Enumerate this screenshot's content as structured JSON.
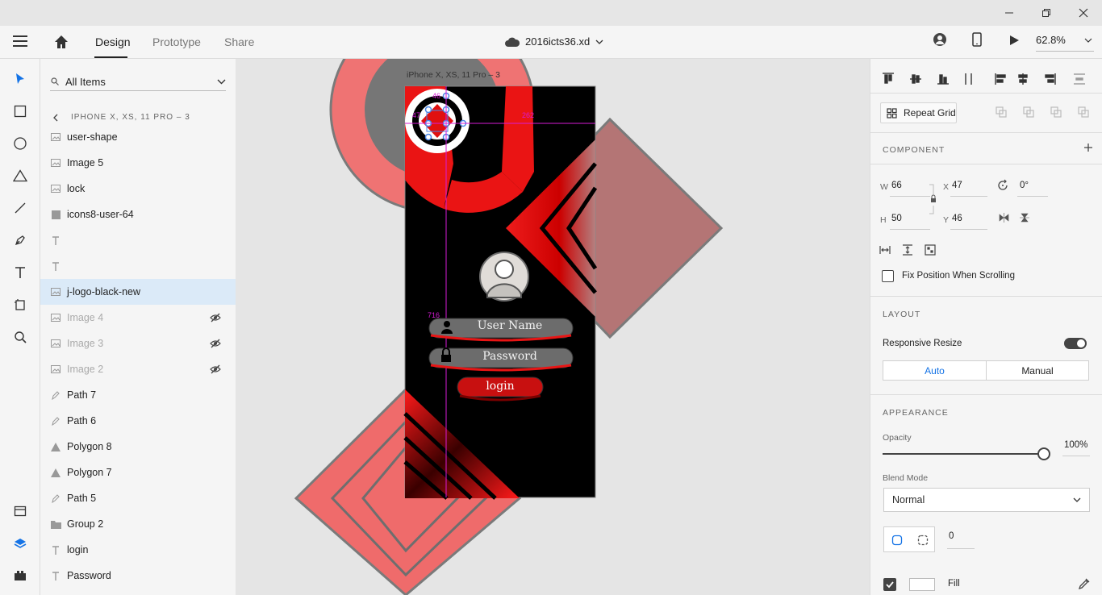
{
  "app": {
    "doc_name": "2016icts36.xd",
    "modes": [
      "Design",
      "Prototype",
      "Share"
    ],
    "zoom": "62.8%"
  },
  "layers": {
    "search_placeholder": "All Items",
    "breadcrumb": "IPHONE X, XS, 11 PRO – 3",
    "items": [
      {
        "name": "user-shape",
        "icon": "image-icon",
        "hidden": false
      },
      {
        "name": "Image 5",
        "icon": "image-icon",
        "hidden": false
      },
      {
        "name": "lock",
        "icon": "image-icon",
        "hidden": false
      },
      {
        "name": "icons8-user-64",
        "icon": "rect-icon",
        "hidden": false
      },
      {
        "name": "",
        "icon": "text-icon",
        "hidden": false
      },
      {
        "name": "",
        "icon": "text-icon",
        "hidden": false
      },
      {
        "name": "j-logo-black-new",
        "icon": "image-icon",
        "hidden": false,
        "selected": true
      },
      {
        "name": "Image 4",
        "icon": "image-icon",
        "hidden": true
      },
      {
        "name": "Image 3",
        "icon": "image-icon",
        "hidden": true
      },
      {
        "name": "Image 2",
        "icon": "image-icon",
        "hidden": true
      },
      {
        "name": "Path 7",
        "icon": "pen-icon",
        "hidden": false
      },
      {
        "name": "Path 6",
        "icon": "pen-icon",
        "hidden": false
      },
      {
        "name": "Polygon 8",
        "icon": "triangle-icon",
        "hidden": false
      },
      {
        "name": "Polygon 7",
        "icon": "triangle-icon",
        "hidden": false
      },
      {
        "name": "Path 5",
        "icon": "pen-icon",
        "hidden": false
      },
      {
        "name": "Group 2",
        "icon": "folder-icon",
        "hidden": false
      },
      {
        "name": "login",
        "icon": "text-icon",
        "hidden": false
      },
      {
        "name": "Password",
        "icon": "text-icon",
        "hidden": false
      }
    ]
  },
  "canvas": {
    "artboard_label": "iPhone X, XS, 11 Pro – 3",
    "measure_top": "46",
    "measure_left": "47",
    "measure_right": "262",
    "measure_bottom": "716",
    "username_label": "User Name",
    "password_label": "Password",
    "login_label": "login"
  },
  "properties": {
    "repeat_grid": "Repeat Grid",
    "component_title": "COMPONENT",
    "w_label": "W",
    "w_value": "66",
    "h_label": "H",
    "h_value": "50",
    "x_label": "X",
    "x_value": "47",
    "y_label": "Y",
    "y_value": "46",
    "rotation": "0°",
    "fix_position": "Fix Position When Scrolling",
    "layout_title": "LAYOUT",
    "responsive_resize": "Responsive Resize",
    "auto": "Auto",
    "manual": "Manual",
    "appearance_title": "APPEARANCE",
    "opacity_label": "Opacity",
    "opacity_value": "100%",
    "blend_label": "Blend Mode",
    "blend_value": "Normal",
    "radius_value": "0",
    "fill_label": "Fill"
  }
}
